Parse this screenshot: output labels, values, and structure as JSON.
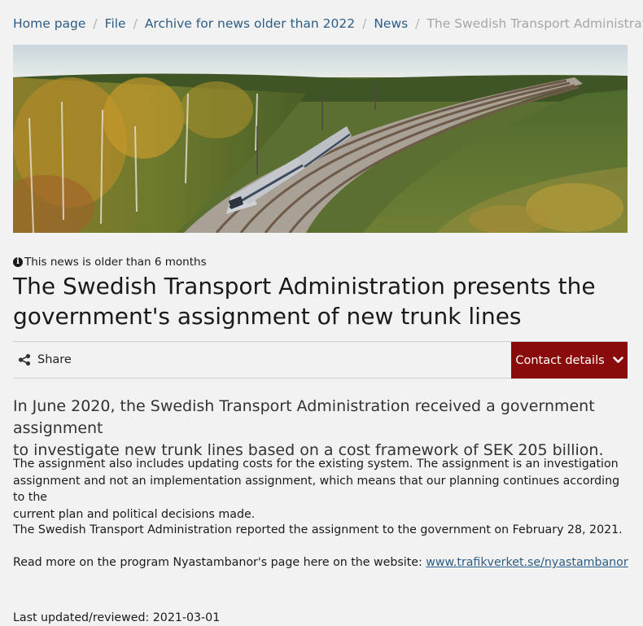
{
  "breadcrumb": {
    "items": [
      "Home page",
      "File",
      "Archive for news older than 2022",
      "News"
    ],
    "current": "The Swedish Transport Administration presents t",
    "separator": "/"
  },
  "hero": {
    "icon": "train-photo-image"
  },
  "notice": {
    "text": "This news is older than 6 months",
    "icon": "info-circle-icon"
  },
  "article": {
    "title_line1": "The Swedish Transport Administration presents the",
    "title_line2": "government's assignment of new trunk lines",
    "lead_line1": "In June 2020, the Swedish Transport Administration received a government assignment",
    "lead_line2": "to investigate new trunk lines based on a cost framework of SEK 205 billion.",
    "p1_line1": "The assignment also includes updating costs for the existing system. The assignment is an investigation",
    "p1_line2": "assignment and not an implementation assignment, which means that our planning continues according to the",
    "p1_line3": "current plan and political decisions made.",
    "p2": "The Swedish Transport Administration reported the assignment to the government on February 28, 2021.",
    "p3_text": "Read more on the program Nyastambanor's page here on the website: ",
    "p3_link": "www.trafikverket.se/nyastambanor"
  },
  "toolbar": {
    "share_label": "Share",
    "share_icon": "share-icon",
    "contact_label": "Contact details",
    "contact_icon": "chevron-down-icon"
  },
  "footer": {
    "updated": "Last updated/reviewed: 2021-03-01"
  },
  "colors": {
    "background": "#f2f2f2",
    "link": "#2d5d86",
    "contact_button": "#8a0b0b",
    "breadcrumb_current": "#a6a6a6"
  }
}
